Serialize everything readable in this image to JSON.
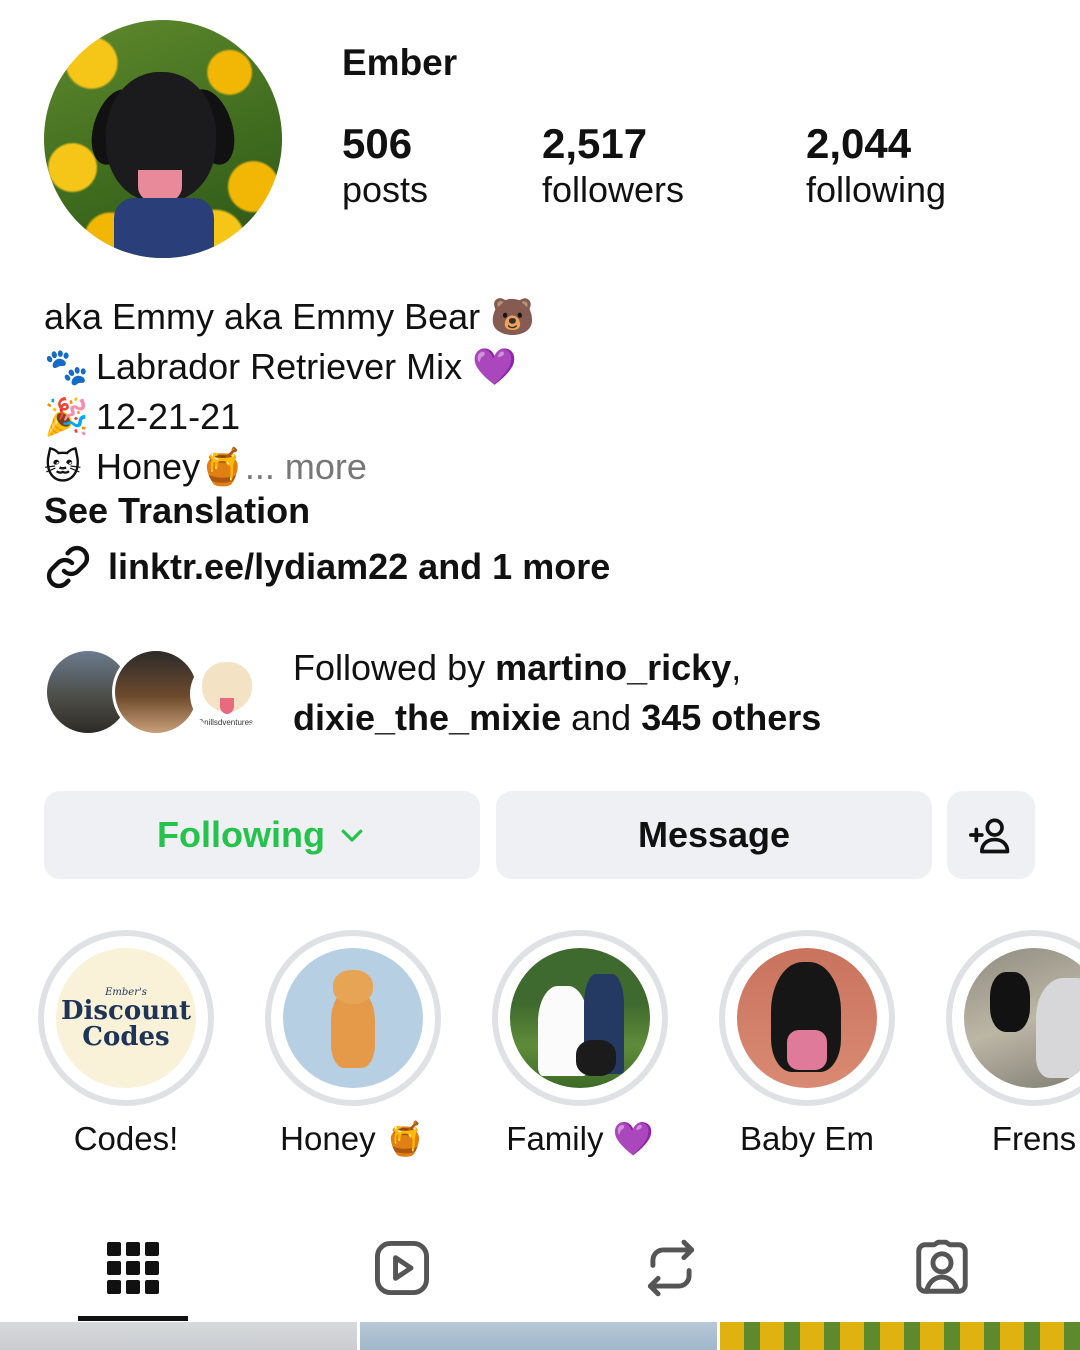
{
  "profile": {
    "username": "Ember",
    "avatar_icon": "dog-avatar",
    "stats": [
      {
        "value": "506",
        "label": "posts"
      },
      {
        "value": "2,517",
        "label": "followers"
      },
      {
        "value": "2,044",
        "label": "following"
      }
    ]
  },
  "bio": {
    "line1_text": "aka Emmy aka Emmy Bear",
    "line1_emoji": "🐻",
    "line2_emoji": "🐾",
    "line2_text": "Labrador Retriever Mix",
    "line2_emoji_end": "💜",
    "line3_emoji": "🎉",
    "line3_text": "12-21-21",
    "line4_emoji": "🐱",
    "line4_text": "Honey",
    "line4_emoji_end": "🍯",
    "more_label": "... more",
    "see_translation": "See Translation",
    "link_text": "linktr.ee/lydiam22 and 1 more"
  },
  "followed_by": {
    "prefix": "Followed by ",
    "user1": "martino_ricky",
    "comma": ",",
    "user2": "dixie_the_mixie",
    "middle": " and ",
    "others": "345 others",
    "avatar3_tag": "@nillsdventures"
  },
  "actions": {
    "following_label": "Following",
    "message_label": "Message",
    "add_user_icon": "add-user-icon"
  },
  "highlights": [
    {
      "label": "Codes!",
      "cover_small": "Ember's",
      "cover_line1": "Discount",
      "cover_line2": "Codes"
    },
    {
      "label": "Honey 🍯"
    },
    {
      "label": "Family 💜"
    },
    {
      "label": "Baby Em"
    },
    {
      "label": "Frens"
    }
  ],
  "tabs": [
    {
      "name": "grid",
      "icon": "grid-icon",
      "selected": true
    },
    {
      "name": "reels",
      "icon": "reels-icon",
      "selected": false
    },
    {
      "name": "reposts",
      "icon": "repost-icon",
      "selected": false
    },
    {
      "name": "tagged",
      "icon": "tagged-icon",
      "selected": false
    }
  ],
  "colors": {
    "following_green": "#25c24c",
    "button_bg": "#eff0f3",
    "more_gray": "#777777"
  }
}
